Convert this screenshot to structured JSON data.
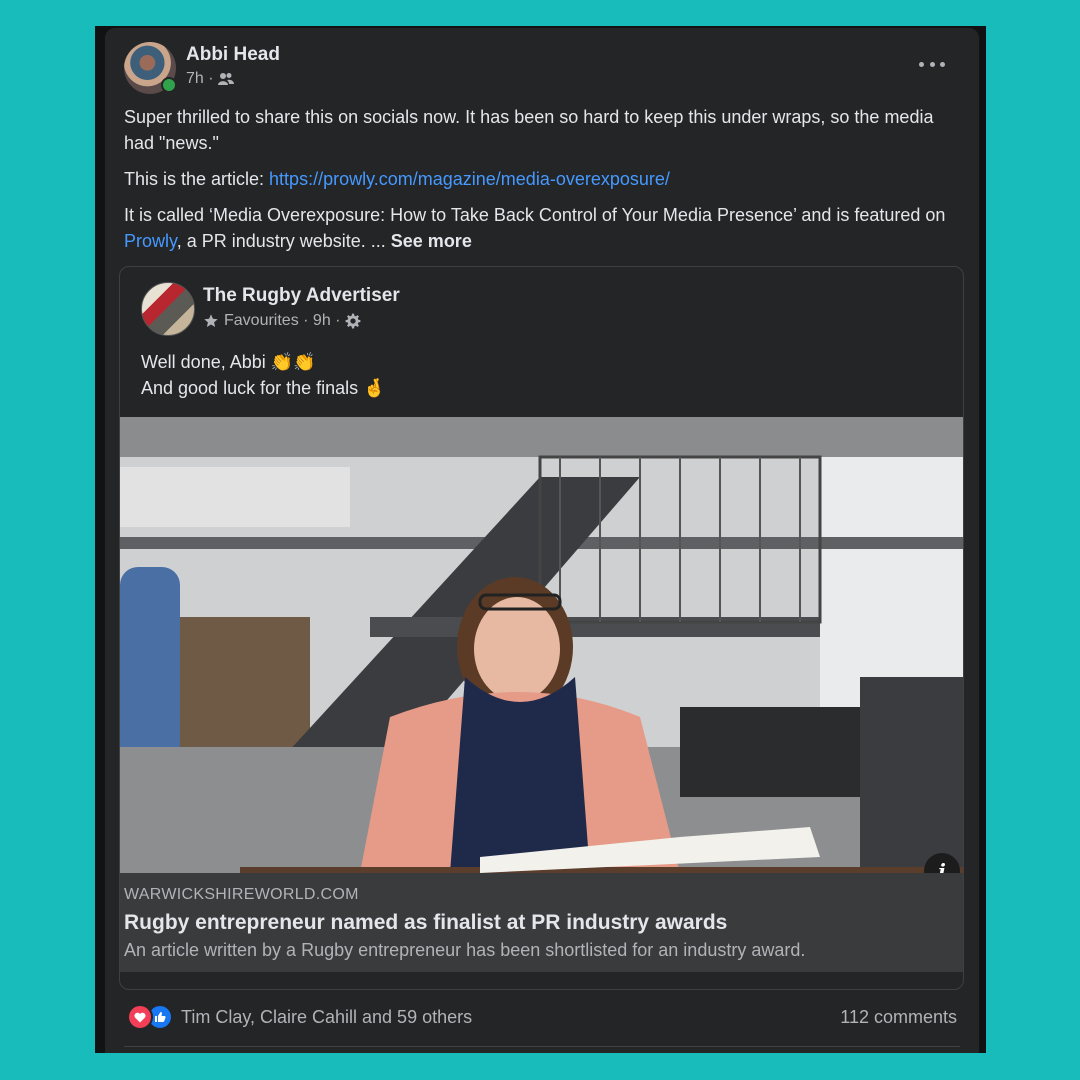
{
  "post": {
    "author": "Abbi Head",
    "time": "7h ·",
    "paragraph1": "Super thrilled to share this on socials now. It has been so hard to keep this under wraps, so the media had \"news.\"",
    "paragraph2_prefix": "This is the article: ",
    "article_link": "https://prowly.com/magazine/media-overexposure/",
    "paragraph3_prefix": "It is called ‘Media Overexposure: How to Take Back Control of Your Media Presence’ and is featured on ",
    "prowly_link": "Prowly",
    "paragraph3_suffix": ", a PR industry website. ... ",
    "see_more": "See more"
  },
  "shared_post": {
    "page_name": "The Rugby Advertiser",
    "meta": "Favourites · 9h ·",
    "line1": "Well done, Abbi 👏👏",
    "line2": "And good luck for the finals 🤞"
  },
  "link_preview": {
    "domain": "WARWICKSHIREWORLD.COM",
    "headline": "Rugby entrepreneur named as finalist at PR industry awards",
    "description": "An article written by a Rugby entrepreneur has been shortlisted for an industry award.",
    "info_glyph": "i"
  },
  "footer": {
    "reactions_text": "Tim Clay, Claire Cahill and 59 others",
    "comments": "112 comments"
  },
  "colors": {
    "background": "#18bdbb",
    "card": "#242526",
    "link": "#4599ff",
    "love": "#f33e58",
    "like": "#1877f2",
    "online": "#31a24c"
  }
}
